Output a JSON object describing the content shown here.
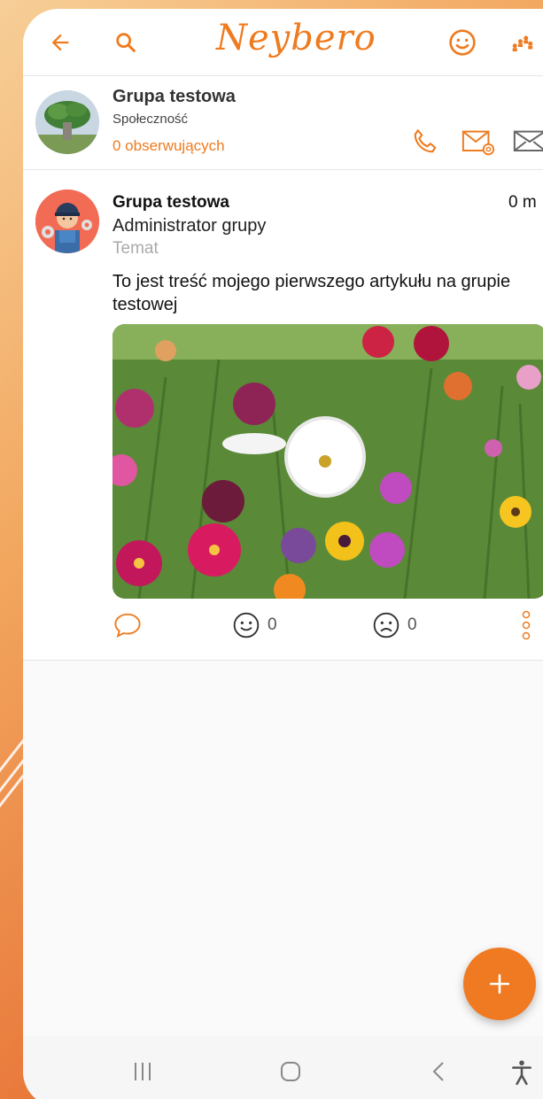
{
  "appbar": {
    "logo": "Neybero",
    "icons": [
      "back-arrow-icon",
      "search-icon",
      "smiley-icon",
      "group-people-icon"
    ]
  },
  "group": {
    "name": "Grupa testowa",
    "type": "Społeczność",
    "followers": "0 obserwujących"
  },
  "post": {
    "author": "Grupa testowa",
    "time": "0 m",
    "role": "Administrator grupy",
    "topic": "Temat",
    "body": "To jest treść mojego pierwszego artykułu na grupie testowej",
    "happy_count": "0",
    "sad_count": "0"
  },
  "colors": {
    "accent": "#ef7b1f",
    "fab": "#f07a22"
  }
}
